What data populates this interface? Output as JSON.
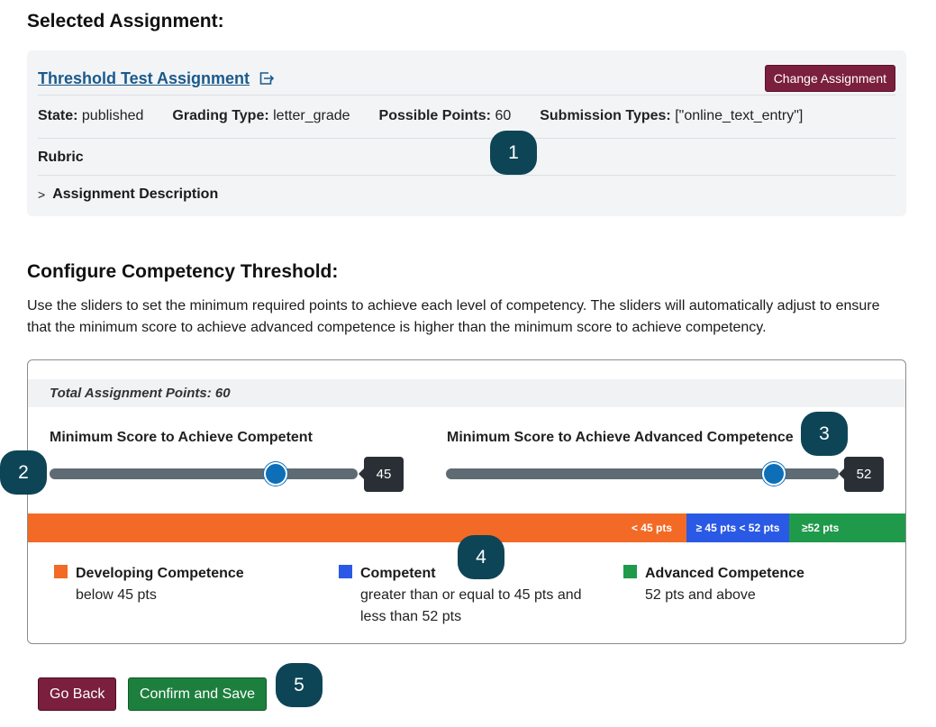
{
  "header": {
    "title": "Selected Assignment:"
  },
  "assignment": {
    "name": "Threshold Test Assignment",
    "change_button": "Change Assignment",
    "state_label": "State:",
    "state": "published",
    "grading_label": "Grading Type:",
    "grading": "letter_grade",
    "points_label": "Possible Points:",
    "points": "60",
    "submission_label": "Submission Types:",
    "submission": "[\"online_text_entry\"]",
    "rubric": "Rubric",
    "description": "Assignment Description"
  },
  "configure": {
    "title": "Configure Competency Threshold:",
    "help": "Use the sliders to set the minimum required points to achieve each level of competency. The sliders will automatically adjust to ensure that the minimum score to achieve advanced competence is higher than the minimum score to achieve competency.",
    "total_points": "Total Assignment Points: 60",
    "slider_competent": {
      "label": "Minimum Score to Achieve Competent",
      "value": "45",
      "min": 0,
      "max": 60
    },
    "slider_advanced": {
      "label": "Minimum Score to Achieve Advanced Competence",
      "value": "52",
      "min": 0,
      "max": 60
    },
    "bar": {
      "developing": "< 45 pts",
      "competent": "≥ 45 pts < 52 pts",
      "advanced": "≥52 pts"
    },
    "legend": [
      {
        "title": "Developing Competence",
        "desc": "below 45 pts",
        "color": "#f26a25"
      },
      {
        "title": "Competent",
        "desc": "greater than or equal to 45 pts and less than 52 pts",
        "color": "#2a59e5"
      },
      {
        "title": "Advanced Competence",
        "desc": "52 pts and above",
        "color": "#1f9a4b"
      }
    ]
  },
  "actions": {
    "back": "Go Back",
    "save": "Confirm and Save"
  },
  "annotations": [
    "1",
    "2",
    "3",
    "4",
    "5"
  ],
  "colors": {
    "primary": "#7a1f3d",
    "success": "#1d7f3e",
    "link": "#1a5a8c",
    "badge": "#0d4557"
  }
}
